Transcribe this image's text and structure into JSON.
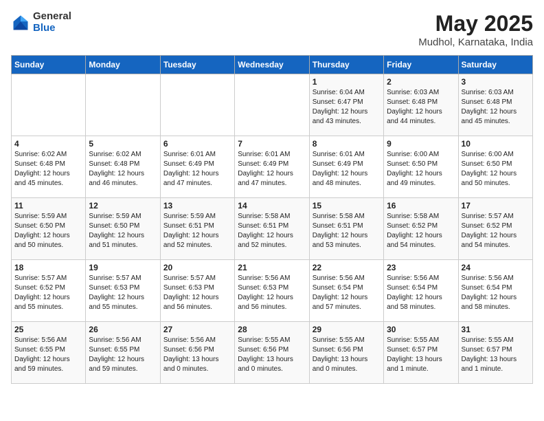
{
  "header": {
    "logo_general": "General",
    "logo_blue": "Blue",
    "title": "May 2025",
    "subtitle": "Mudhol, Karnataka, India"
  },
  "days_of_week": [
    "Sunday",
    "Monday",
    "Tuesday",
    "Wednesday",
    "Thursday",
    "Friday",
    "Saturday"
  ],
  "weeks": [
    [
      {
        "day": "",
        "info": ""
      },
      {
        "day": "",
        "info": ""
      },
      {
        "day": "",
        "info": ""
      },
      {
        "day": "",
        "info": ""
      },
      {
        "day": "1",
        "info": "Sunrise: 6:04 AM\nSunset: 6:47 PM\nDaylight: 12 hours\nand 43 minutes."
      },
      {
        "day": "2",
        "info": "Sunrise: 6:03 AM\nSunset: 6:48 PM\nDaylight: 12 hours\nand 44 minutes."
      },
      {
        "day": "3",
        "info": "Sunrise: 6:03 AM\nSunset: 6:48 PM\nDaylight: 12 hours\nand 45 minutes."
      }
    ],
    [
      {
        "day": "4",
        "info": "Sunrise: 6:02 AM\nSunset: 6:48 PM\nDaylight: 12 hours\nand 45 minutes."
      },
      {
        "day": "5",
        "info": "Sunrise: 6:02 AM\nSunset: 6:48 PM\nDaylight: 12 hours\nand 46 minutes."
      },
      {
        "day": "6",
        "info": "Sunrise: 6:01 AM\nSunset: 6:49 PM\nDaylight: 12 hours\nand 47 minutes."
      },
      {
        "day": "7",
        "info": "Sunrise: 6:01 AM\nSunset: 6:49 PM\nDaylight: 12 hours\nand 47 minutes."
      },
      {
        "day": "8",
        "info": "Sunrise: 6:01 AM\nSunset: 6:49 PM\nDaylight: 12 hours\nand 48 minutes."
      },
      {
        "day": "9",
        "info": "Sunrise: 6:00 AM\nSunset: 6:50 PM\nDaylight: 12 hours\nand 49 minutes."
      },
      {
        "day": "10",
        "info": "Sunrise: 6:00 AM\nSunset: 6:50 PM\nDaylight: 12 hours\nand 50 minutes."
      }
    ],
    [
      {
        "day": "11",
        "info": "Sunrise: 5:59 AM\nSunset: 6:50 PM\nDaylight: 12 hours\nand 50 minutes."
      },
      {
        "day": "12",
        "info": "Sunrise: 5:59 AM\nSunset: 6:50 PM\nDaylight: 12 hours\nand 51 minutes."
      },
      {
        "day": "13",
        "info": "Sunrise: 5:59 AM\nSunset: 6:51 PM\nDaylight: 12 hours\nand 52 minutes."
      },
      {
        "day": "14",
        "info": "Sunrise: 5:58 AM\nSunset: 6:51 PM\nDaylight: 12 hours\nand 52 minutes."
      },
      {
        "day": "15",
        "info": "Sunrise: 5:58 AM\nSunset: 6:51 PM\nDaylight: 12 hours\nand 53 minutes."
      },
      {
        "day": "16",
        "info": "Sunrise: 5:58 AM\nSunset: 6:52 PM\nDaylight: 12 hours\nand 54 minutes."
      },
      {
        "day": "17",
        "info": "Sunrise: 5:57 AM\nSunset: 6:52 PM\nDaylight: 12 hours\nand 54 minutes."
      }
    ],
    [
      {
        "day": "18",
        "info": "Sunrise: 5:57 AM\nSunset: 6:52 PM\nDaylight: 12 hours\nand 55 minutes."
      },
      {
        "day": "19",
        "info": "Sunrise: 5:57 AM\nSunset: 6:53 PM\nDaylight: 12 hours\nand 55 minutes."
      },
      {
        "day": "20",
        "info": "Sunrise: 5:57 AM\nSunset: 6:53 PM\nDaylight: 12 hours\nand 56 minutes."
      },
      {
        "day": "21",
        "info": "Sunrise: 5:56 AM\nSunset: 6:53 PM\nDaylight: 12 hours\nand 56 minutes."
      },
      {
        "day": "22",
        "info": "Sunrise: 5:56 AM\nSunset: 6:54 PM\nDaylight: 12 hours\nand 57 minutes."
      },
      {
        "day": "23",
        "info": "Sunrise: 5:56 AM\nSunset: 6:54 PM\nDaylight: 12 hours\nand 58 minutes."
      },
      {
        "day": "24",
        "info": "Sunrise: 5:56 AM\nSunset: 6:54 PM\nDaylight: 12 hours\nand 58 minutes."
      }
    ],
    [
      {
        "day": "25",
        "info": "Sunrise: 5:56 AM\nSunset: 6:55 PM\nDaylight: 12 hours\nand 59 minutes."
      },
      {
        "day": "26",
        "info": "Sunrise: 5:56 AM\nSunset: 6:55 PM\nDaylight: 12 hours\nand 59 minutes."
      },
      {
        "day": "27",
        "info": "Sunrise: 5:56 AM\nSunset: 6:56 PM\nDaylight: 13 hours\nand 0 minutes."
      },
      {
        "day": "28",
        "info": "Sunrise: 5:55 AM\nSunset: 6:56 PM\nDaylight: 13 hours\nand 0 minutes."
      },
      {
        "day": "29",
        "info": "Sunrise: 5:55 AM\nSunset: 6:56 PM\nDaylight: 13 hours\nand 0 minutes."
      },
      {
        "day": "30",
        "info": "Sunrise: 5:55 AM\nSunset: 6:57 PM\nDaylight: 13 hours\nand 1 minute."
      },
      {
        "day": "31",
        "info": "Sunrise: 5:55 AM\nSunset: 6:57 PM\nDaylight: 13 hours\nand 1 minute."
      }
    ]
  ]
}
